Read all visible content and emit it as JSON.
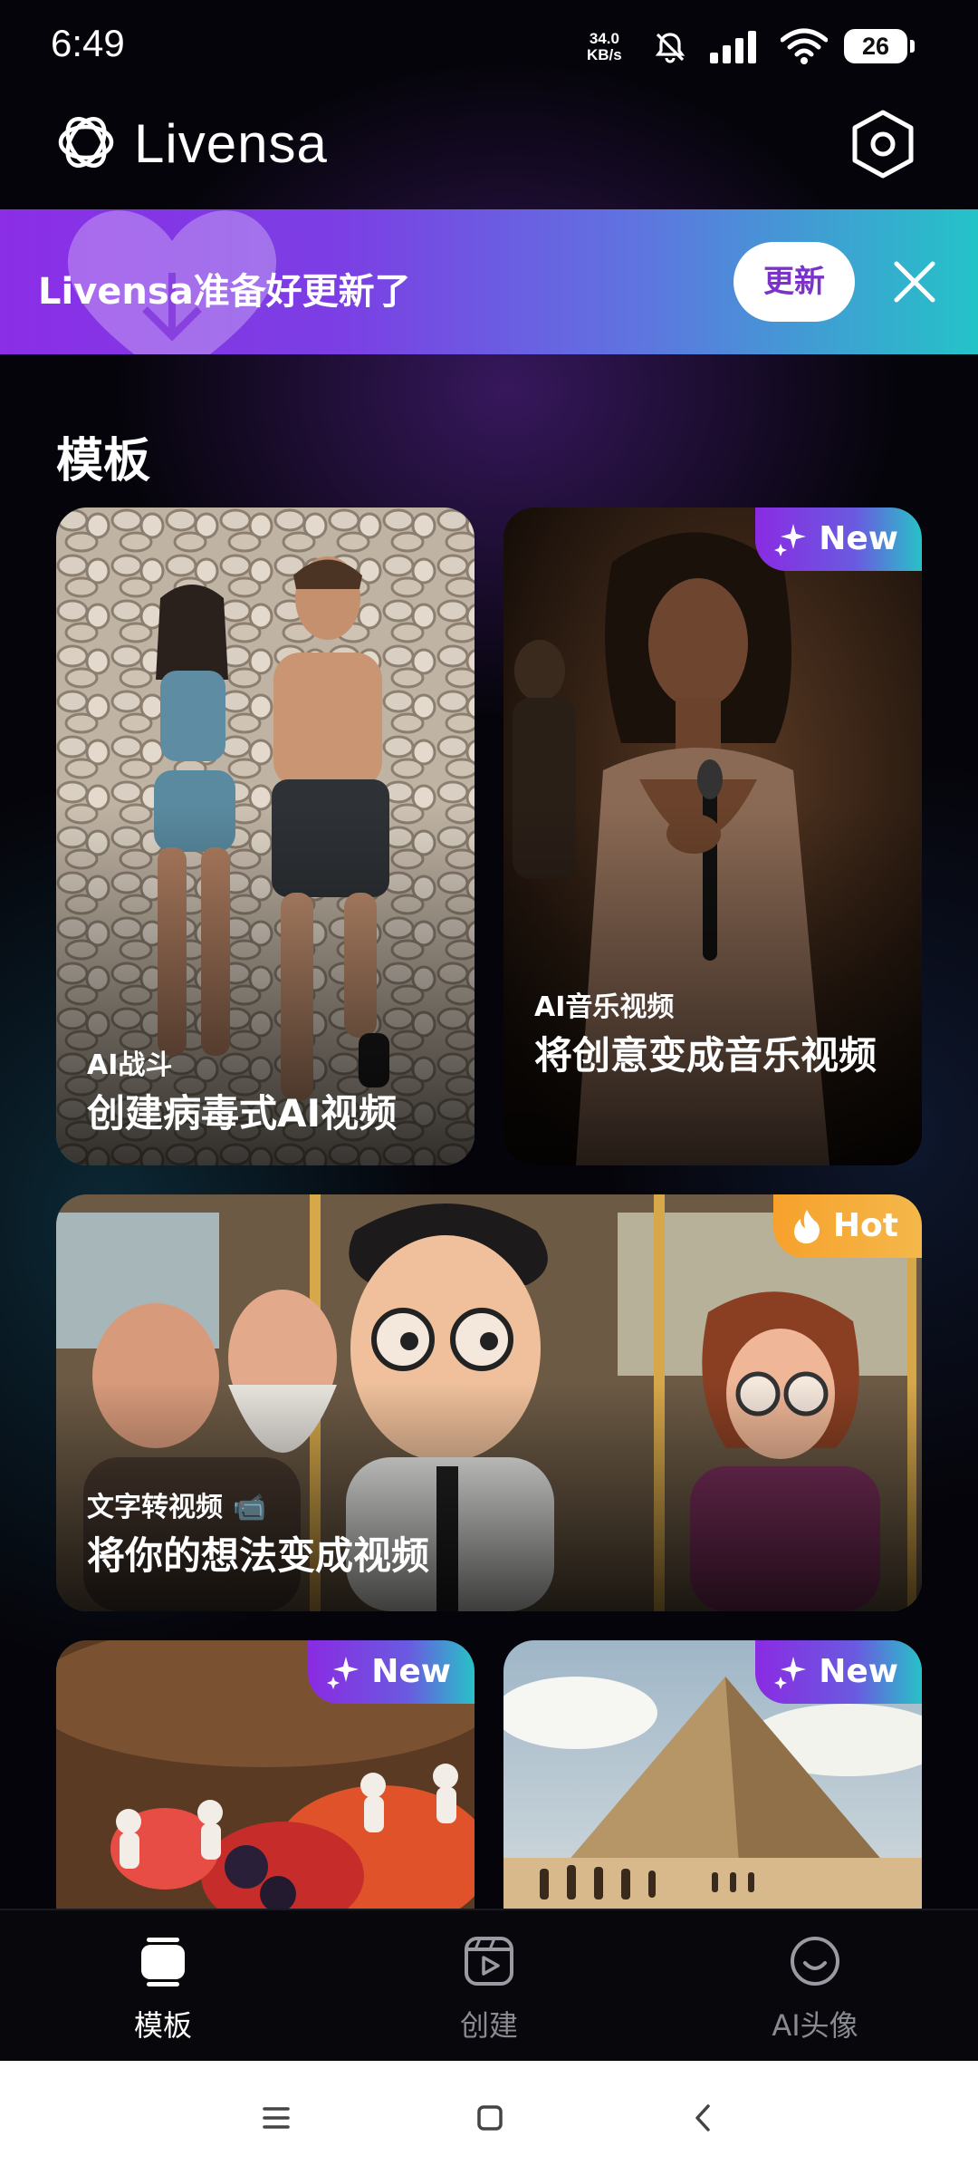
{
  "status_bar": {
    "time": "6:49",
    "net_speed_value": "34.0",
    "net_speed_unit": "KB/s",
    "battery": "26",
    "icons": [
      "mute-bell-icon",
      "signal-icon",
      "wifi-icon",
      "battery-icon"
    ]
  },
  "app_bar": {
    "title": "Livensa",
    "logo_icon": "livensa-logo-icon",
    "settings_icon": "settings-hexagon-icon"
  },
  "update_banner": {
    "text": "Livensa准备好更新了",
    "button_label": "更新",
    "close_icon": "close-icon"
  },
  "section": {
    "title": "模板"
  },
  "cards": [
    {
      "tag": "AI战斗",
      "title": "创建病毒式AI视频",
      "badge": ""
    },
    {
      "tag": "AI音乐视频",
      "title": "将创意变成音乐视频",
      "badge": "New"
    },
    {
      "tag": "文字转视频 📹",
      "title": "将你的想法变成视频",
      "badge": "Hot"
    },
    {
      "tag": "",
      "title": "",
      "badge": "New"
    },
    {
      "tag": "",
      "title": "",
      "badge": "New"
    }
  ],
  "bottom_nav": {
    "items": [
      {
        "label": "模板",
        "icon": "templates-icon",
        "active": true
      },
      {
        "label": "创建",
        "icon": "create-video-icon",
        "active": false
      },
      {
        "label": "AI头像",
        "icon": "ai-avatar-icon",
        "active": false
      }
    ]
  },
  "colors": {
    "accent_purple": "#8a2be2",
    "accent_teal": "#27c2c7",
    "hot_orange": "#f7a12c",
    "background": "#05040a"
  }
}
